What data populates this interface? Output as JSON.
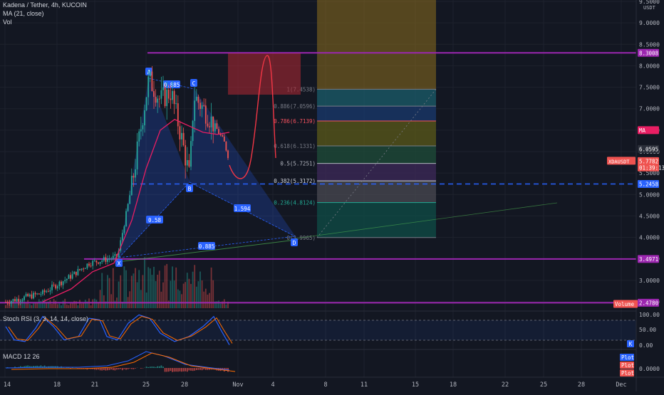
{
  "header": {
    "symbol_line": "Kadena / Tether, 4h, KUCOIN",
    "ma_label": "MA (21, close)",
    "vol_label": "Vol"
  },
  "price_axis": {
    "currency": "USDT",
    "ticks": [
      "9.5000",
      "9.0000",
      "8.5000",
      "8.0000",
      "7.5000",
      "7.0000",
      "6.5000",
      "6.0000",
      "5.5000",
      "5.0000",
      "4.5000",
      "4.0000",
      "3.5000",
      "3.0000",
      "2.5000"
    ],
    "tick_values": [
      9.5,
      9.0,
      8.5,
      8.0,
      7.5,
      7.0,
      6.5,
      6.0,
      5.5,
      5.0,
      4.5,
      4.0,
      3.5,
      3.0,
      2.5
    ],
    "badges": [
      {
        "label": "8.3008",
        "value": 8.3008,
        "color": "#9c27b0"
      },
      {
        "label": "MA",
        "value": 6.5,
        "color": "#e91e63"
      },
      {
        "label": "6.0595",
        "value": 6.0595,
        "color": "#2a2e39"
      },
      {
        "label": "5.7782",
        "value": 5.7782,
        "color": "#ef5350"
      },
      {
        "label": "01:39:13",
        "value": 5.63,
        "color": "#ef5350"
      },
      {
        "label": "5.2458",
        "value": 5.2458,
        "color": "#2962ff"
      },
      {
        "label": "3.4971",
        "value": 3.4971,
        "color": "#9c27b0"
      },
      {
        "label": "2.4780",
        "value": 2.478,
        "color": "#9c27b0"
      },
      {
        "label": "Volume",
        "value": 2.45,
        "color": "#ef5350"
      }
    ],
    "symbol_tag": "XDAUSDT"
  },
  "harmonic": {
    "points": [
      {
        "label": "X",
        "x": "Oct 22",
        "y": 3.47
      },
      {
        "label": "A",
        "x": "Oct 25",
        "y": 7.85
      },
      {
        "label": "B",
        "x": "Oct 27",
        "y": 5.15
      },
      {
        "label": "C",
        "x": "Oct 28",
        "y": 7.55
      },
      {
        "label": "D",
        "x": "Nov 5",
        "y": 3.98
      }
    ],
    "ratios": [
      "0.58",
      "0.885",
      "1.594",
      "0.885"
    ]
  },
  "fib_levels": [
    {
      "label": "1(7.4538)",
      "value": 7.4538,
      "color": "#787b86"
    },
    {
      "label": "0.886(7.0596)",
      "value": 7.0596,
      "color": "#787b86"
    },
    {
      "label": "0.786(6.7139)",
      "value": 6.7139,
      "color": "#f7525f"
    },
    {
      "label": "0.618(6.1331)",
      "value": 6.1331,
      "color": "#787b86"
    },
    {
      "label": "0.5(5.7251)",
      "value": 5.7251,
      "color": "#b2b5be"
    },
    {
      "label": "0.382(5.3172)",
      "value": 5.3172,
      "color": "#d1d4dc"
    },
    {
      "label": "0.236(4.8124)",
      "value": 4.8124,
      "color": "#22ab94"
    },
    {
      "label": "0(3.9965)",
      "value": 3.9965,
      "color": "#787b86"
    }
  ],
  "horizontal_lines": [
    {
      "value": 8.3008,
      "color": "#9c27b0"
    },
    {
      "value": 3.4971,
      "color": "#9c27b0"
    },
    {
      "value": 2.478,
      "color": "#9c27b0"
    },
    {
      "value": 5.2458,
      "color": "#2962ff",
      "dashed": true
    }
  ],
  "stoch": {
    "label": "Stoch RSI (3, 3, 14, 14, close)",
    "ticks": [
      "100.00",
      "50.00",
      "0.00"
    ],
    "k_badge": "K"
  },
  "macd": {
    "label": "MACD 12 26",
    "ticks": [
      "0.0000"
    ],
    "plot_badges": [
      "Plot",
      "Plot",
      "Plot"
    ]
  },
  "time_axis": {
    "labels": [
      "14",
      "18",
      "21",
      "25",
      "28",
      "Nov",
      "4",
      "8",
      "11",
      "15",
      "18",
      "22",
      "25",
      "28",
      "Dec"
    ]
  },
  "chart_data": {
    "type": "line",
    "title": "Kadena / Tether, 4h, KUCOIN",
    "series": [
      {
        "name": "MA (21, close)",
        "x": [
          "Oct 20",
          "Oct 22",
          "Oct 24",
          "Oct 25",
          "Oct 26",
          "Oct 27",
          "Oct 28",
          "Oct 29",
          "Oct 30"
        ],
        "values": [
          2.55,
          3.3,
          4.9,
          6.2,
          6.7,
          6.6,
          6.5,
          6.45,
          6.4
        ]
      }
    ],
    "ylim": [
      2.3,
      9.6
    ],
    "price_labels": [
      9.5,
      9.0,
      8.5,
      8.0,
      7.5,
      7.0,
      6.5,
      6.0,
      5.5,
      5.0,
      4.5,
      4.0,
      3.5,
      3.0,
      2.5
    ]
  },
  "colors": {
    "background": "#131722",
    "up": "#26a69a",
    "down": "#ef5350",
    "harmonic_fill": "#2962ff",
    "projection_curve": "#f23645"
  }
}
